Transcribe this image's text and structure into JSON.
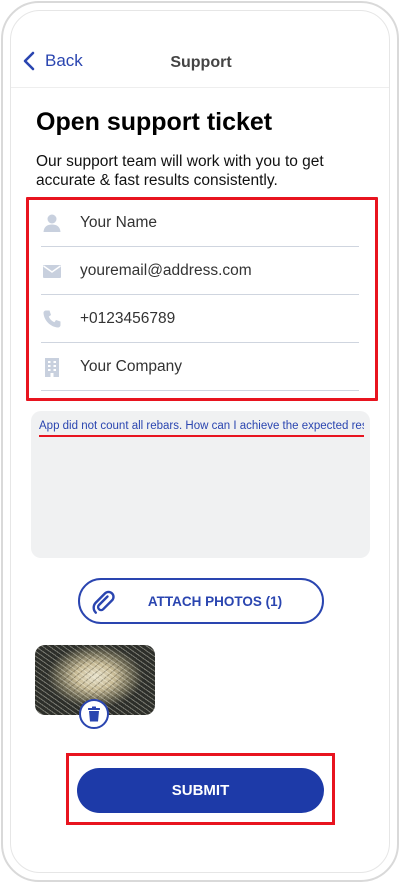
{
  "nav": {
    "back_label": "Back",
    "title": "Support"
  },
  "header": {
    "title": "Open support ticket",
    "subtitle": "Our support team will work with you to get accurate & fast results consistently."
  },
  "form": {
    "name_placeholder": "Your Name",
    "email_value": "youremail@address.com",
    "phone_value": "+0123456789",
    "company_placeholder": "Your Company"
  },
  "message": {
    "value": "App did not count all rebars. How can I achieve the expected results?"
  },
  "attach": {
    "label": "ATTACH PHOTOS (1)"
  },
  "submit": {
    "label": "SUBMIT"
  },
  "colors": {
    "accent": "#1d3aa8",
    "highlight": "#e8141f",
    "field_bg": "#f0f1f2"
  }
}
